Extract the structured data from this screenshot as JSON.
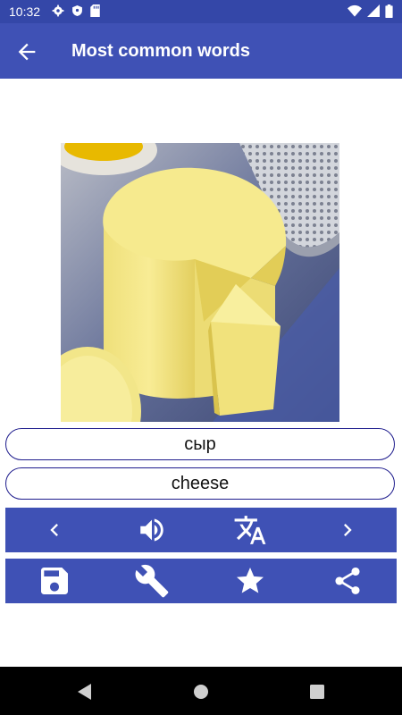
{
  "status_bar": {
    "time": "10:32",
    "left_icons": [
      "gear-icon",
      "shield-icon",
      "sd-card-icon"
    ],
    "right_icons": [
      "wifi-icon",
      "cell-signal-icon",
      "battery-icon"
    ]
  },
  "app_bar": {
    "title": "Most common words",
    "back_icon": "arrow-back-icon",
    "color": "#3f51b5"
  },
  "card": {
    "image": "cheese-picture",
    "word": "сыр",
    "translation": "cheese"
  },
  "controls_row1": [
    "chevron-left-icon",
    "volume-icon",
    "translate-icon",
    "chevron-right-icon"
  ],
  "controls_row2": [
    "save-icon",
    "wrench-icon",
    "star-icon",
    "share-icon"
  ],
  "nav_bar": [
    "back-triangle-icon",
    "home-circle-icon",
    "recents-square-icon"
  ],
  "colors": {
    "primary": "#3f51b5",
    "status_bar": "#3447a8",
    "pill_border": "#1d1b8c"
  }
}
